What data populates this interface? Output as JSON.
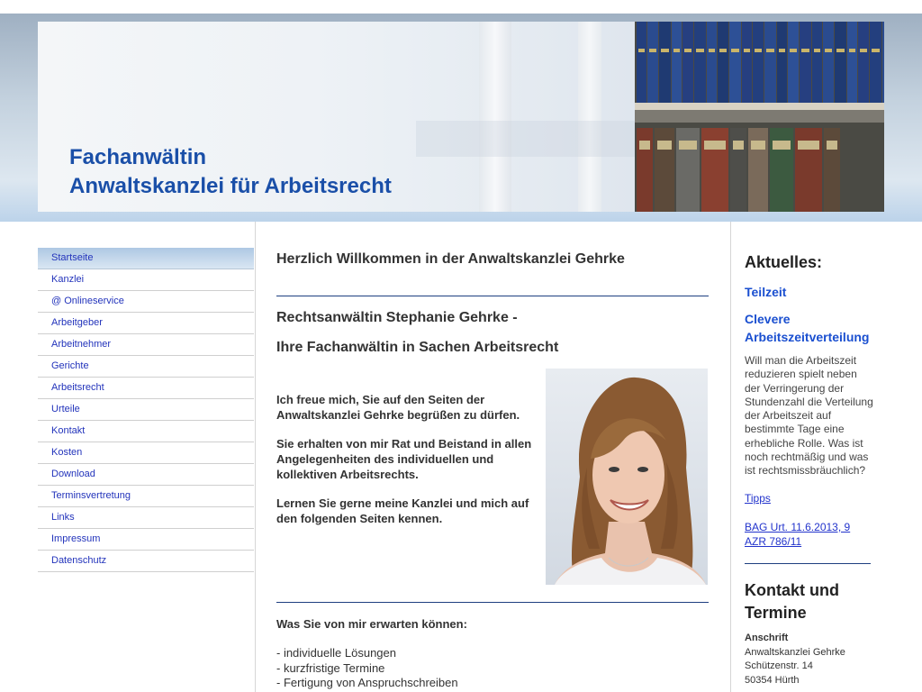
{
  "header": {
    "title_line1": "Fachanwältin",
    "title_line2": "Anwaltskanzlei für Arbeitsrecht"
  },
  "nav": {
    "items": [
      {
        "label": "Startseite",
        "active": true
      },
      {
        "label": "Kanzlei"
      },
      {
        "label": "@ Onlineservice"
      },
      {
        "label": "Arbeitgeber"
      },
      {
        "label": "Arbeitnehmer"
      },
      {
        "label": "Gerichte"
      },
      {
        "label": "Arbeitsrecht"
      },
      {
        "label": "Urteile"
      },
      {
        "label": "Kontakt"
      },
      {
        "label": "Kosten"
      },
      {
        "label": "Download"
      },
      {
        "label": "Terminsvertretung"
      },
      {
        "label": "Links"
      },
      {
        "label": "Impressum"
      },
      {
        "label": "Datenschutz"
      }
    ]
  },
  "main": {
    "welcome": "Herzlich Willkommen in der Anwaltskanzlei Gehrke",
    "subtitle1": "Rechtsanwältin Stephanie Gehrke -",
    "subtitle2": "Ihre Fachanwältin in Sachen Arbeitsrecht",
    "para1": "Ich freue mich, Sie auf den Seiten der Anwaltskanzlei Gehrke begrüßen zu dürfen.",
    "para2": "Sie erhalten von mir Rat und Beistand in allen Angelegenheiten des individuellen und kollektiven Arbeitsrechts.",
    "para3": "Lernen Sie gerne meine Kanzlei und mich auf den folgenden Seiten kennen.",
    "expect_heading": "Was Sie von mir erwarten können:",
    "expect_items": [
      "- individuelle Lösungen",
      "- kurzfristige Termine",
      "- Fertigung von Anspruchschreiben"
    ]
  },
  "right": {
    "news_heading": "Aktuelles:",
    "news_link1": "Teilzeit",
    "news_link2": "Clevere Arbeitszeitverteilung",
    "news_text": "Will man die Arbeitszeit reduzieren spielt neben der Verringerung der Stundenzahl die Verteilung der Arbeitszeit auf bestimmte Tage eine erhebliche Rolle. Was ist noch rechtmäßig und was ist rechtsmissbräuchlich?",
    "tipps_link": "Tipps",
    "bag_link": "BAG Urt. 11.6.2013, 9 AZR 786/11",
    "contact_heading": "Kontakt und Termine",
    "address_label": "Anschrift",
    "address_lines": [
      "Anwaltskanzlei Gehrke",
      "Schützenstr. 14",
      "50354 Hürth"
    ]
  },
  "colors": {
    "title_blue": "#1a4fa8",
    "nav_link": "#2233bb",
    "divider_navy": "#1e3f80"
  }
}
